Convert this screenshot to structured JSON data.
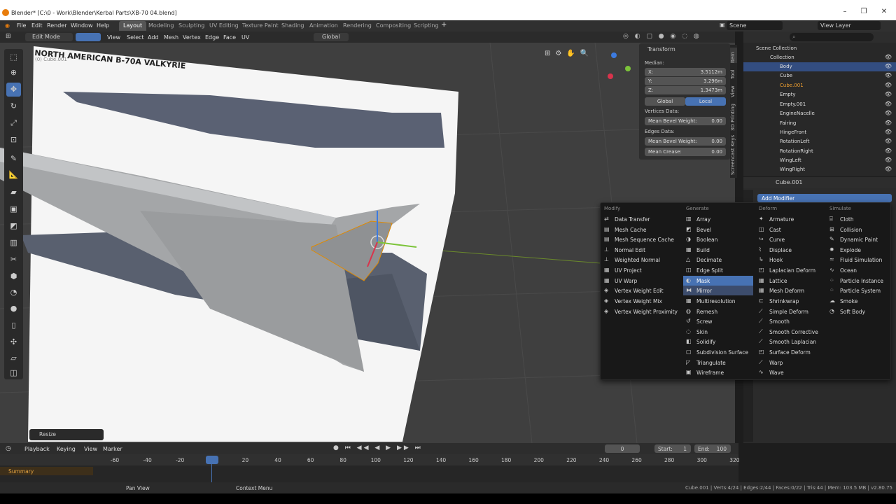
{
  "window": {
    "title": "Blender* [C:\\0 - Work\\Blender\\Kerbal Parts\\XB-70 04.blend]"
  },
  "menu": [
    "File",
    "Edit",
    "Render",
    "Window",
    "Help"
  ],
  "workspaces": [
    "Layout",
    "Modeling",
    "Sculpting",
    "UV Editing",
    "Texture Paint",
    "Shading",
    "Animation",
    "Rendering",
    "Compositing",
    "Scripting"
  ],
  "active_workspace": "Layout",
  "scene": "Scene",
  "view_layer": "View Layer",
  "header3d": {
    "mode": "Edit Mode",
    "items": [
      "View",
      "Select",
      "Add",
      "Mesh",
      "Vertex",
      "Edge",
      "Face",
      "UV"
    ],
    "orientation": "Global"
  },
  "viewport": {
    "image_title": "NORTH AMERICAN B-70A VALKYRIE",
    "object_label": "(0) Cube.001",
    "resize_label": "Resize"
  },
  "npanel": {
    "section": "Transform",
    "median_label": "Median:",
    "x_label": "X:",
    "x": "3.5112m",
    "y_label": "Y:",
    "y": "3.296m",
    "z_label": "Z:",
    "z": "1.3473m",
    "global": "Global",
    "local": "Local",
    "vertices_data": "Vertices Data:",
    "mean_bevel_weight": "Mean Bevel Weight:",
    "mbw_value": "0.00",
    "edges_data": "Edges Data:",
    "mean_bevel_weight2": "Mean Bevel Weight:",
    "mbw2_value": "0.00",
    "mean_crease": "Mean Crease:",
    "mc_value": "0.00"
  },
  "side_tabs": [
    "Item",
    "Tool",
    "View",
    "3D Printing",
    "Screencast Keys"
  ],
  "outliner": {
    "root": "Scene Collection",
    "collection": "Collection",
    "items": [
      "Body",
      "Cube",
      "Cube.001",
      "Empty",
      "Empty.001",
      "EngineNacelle",
      "Fairing",
      "HingeFront",
      "RotationLeft",
      "RotationRight",
      "WingLeft",
      "WingRight"
    ]
  },
  "properties": {
    "object": "Cube.001",
    "add_modifier": "Add Modifier"
  },
  "modifier_menu": {
    "modify_title": "Modify",
    "generate_title": "Generate",
    "deform_title": "Deform",
    "simulate_title": "Simulate",
    "modify": [
      "Data Transfer",
      "Mesh Cache",
      "Mesh Sequence Cache",
      "Normal Edit",
      "Weighted Normal",
      "UV Project",
      "UV Warp",
      "Vertex Weight Edit",
      "Vertex Weight Mix",
      "Vertex Weight Proximity"
    ],
    "generate": [
      "Array",
      "Bevel",
      "Boolean",
      "Build",
      "Decimate",
      "Edge Split",
      "Mask",
      "Mirror",
      "Multiresolution",
      "Remesh",
      "Screw",
      "Skin",
      "Solidify",
      "Subdivision Surface",
      "Triangulate",
      "Wireframe"
    ],
    "deform": [
      "Armature",
      "Cast",
      "Curve",
      "Displace",
      "Hook",
      "Laplacian Deform",
      "Lattice",
      "Mesh Deform",
      "Shrinkwrap",
      "Simple Deform",
      "Smooth",
      "Smooth Corrective",
      "Smooth Laplacian",
      "Surface Deform",
      "Warp",
      "Wave"
    ],
    "simulate": [
      "Cloth",
      "Collision",
      "Dynamic Paint",
      "Explode",
      "Fluid Simulation",
      "Ocean",
      "Particle Instance",
      "Particle System",
      "Smoke",
      "Soft Body"
    ]
  },
  "timeline": {
    "menus": [
      "Playback",
      "Keying",
      "View",
      "Marker"
    ],
    "current_frame": "0",
    "start_label": "Start:",
    "start": "1",
    "end_label": "End:",
    "end": "100",
    "ticks": [
      "-60",
      "-40",
      "-20",
      "0",
      "20",
      "40",
      "60",
      "80",
      "100",
      "120",
      "140",
      "160",
      "180",
      "200",
      "220",
      "240",
      "260",
      "280",
      "300",
      "320"
    ],
    "summary": "Summary"
  },
  "status": {
    "pan": "Pan View",
    "context": "Context Menu",
    "info": "Cube.001 | Verts:4/24 | Edges:2/44 | Faces:0/22 | Tris:44 | Mem: 103.5 MB | v2.80.75"
  }
}
